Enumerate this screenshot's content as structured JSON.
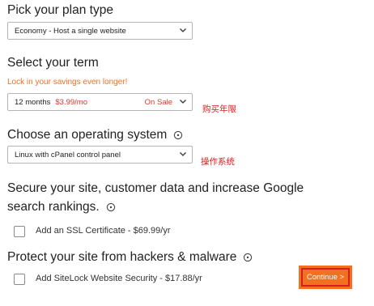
{
  "plan": {
    "heading": "Pick your plan type",
    "selected": "Economy - Host a single website"
  },
  "term": {
    "heading": "Select your term",
    "note": "Lock in your savings even longer!",
    "selected": "12 months",
    "price": "$3.99/mo",
    "badge": "On Sale",
    "annotation": "购买年限"
  },
  "os": {
    "heading": "Choose an operating system",
    "selected": "Linux with cPanel control panel",
    "annotation": "操作系统"
  },
  "ssl": {
    "heading_line1": "Secure your site, customer data and increase Google",
    "heading_line2": "search rankings.",
    "checkbox_label": "Add an SSL Certificate - $69.99/yr"
  },
  "sitelock": {
    "heading": "Protect your site from hackers & malware",
    "checkbox_label": "Add SiteLock Website Security - $17.88/yr"
  },
  "continue_label": "Continue >",
  "colors": {
    "accent": "#f37021",
    "sale": "#d33a2c",
    "annotation": "#d81e1e"
  }
}
